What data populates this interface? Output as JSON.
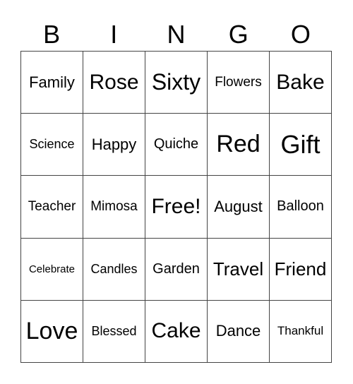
{
  "header": [
    "B",
    "I",
    "N",
    "G",
    "O"
  ],
  "cells": [
    "Family",
    "Rose",
    "Sixty",
    "Flowers",
    "Bake",
    "Science",
    "Happy",
    "Quiche",
    "Red",
    "Gift",
    "Teacher",
    "Mimosa",
    "Free!",
    "August",
    "Balloon",
    "Celebrate",
    "Candles",
    "Garden",
    "Travel",
    "Friend",
    "Love",
    "Blessed",
    "Cake",
    "Dance",
    "Thankful"
  ]
}
